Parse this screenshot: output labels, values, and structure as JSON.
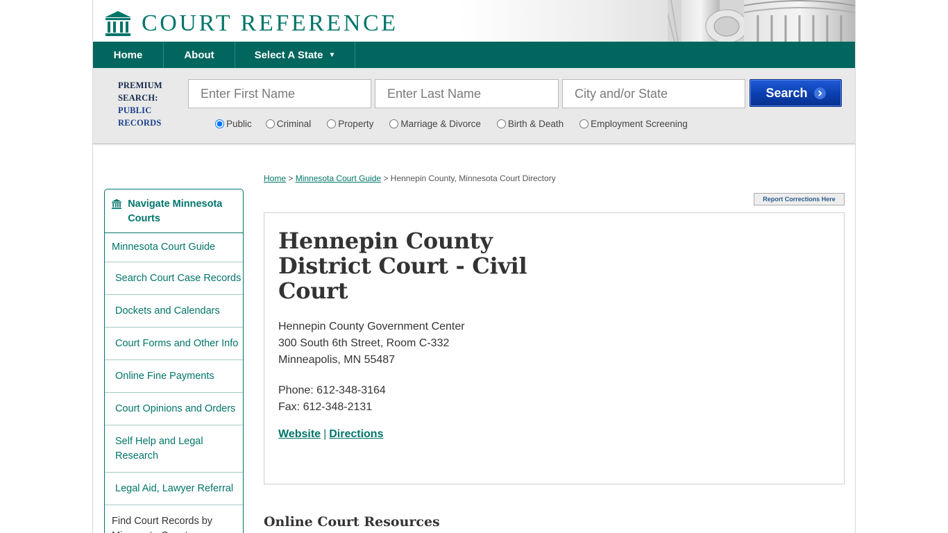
{
  "header": {
    "logo_text": "COURT REFERENCE",
    "brand_color": "#00756a",
    "icons": {
      "logo": "courthouse-icon"
    }
  },
  "nav": {
    "items": [
      {
        "label": "Home"
      },
      {
        "label": "About"
      },
      {
        "label": "Select A State",
        "caret": "▼"
      }
    ],
    "background": "#00665e"
  },
  "search": {
    "premium_line1": "PREMIUM",
    "premium_line2": "SEARCH:",
    "premium_line3": "PUBLIC",
    "premium_line4": "RECORDS",
    "first_name_placeholder": "Enter First Name",
    "last_name_placeholder": "Enter Last Name",
    "city_placeholder": "City and/or State",
    "button_label": "Search",
    "button_icon": "chevron-right-icon",
    "options": [
      {
        "label": "Public",
        "checked": true
      },
      {
        "label": "Criminal",
        "checked": false
      },
      {
        "label": "Property",
        "checked": false
      },
      {
        "label": "Marriage & Divorce",
        "checked": false
      },
      {
        "label": "Birth & Death",
        "checked": false
      },
      {
        "label": "Employment Screening",
        "checked": false
      }
    ]
  },
  "breadcrumb": {
    "home": "Home",
    "sep1": " > ",
    "guide": "Minnesota Court Guide",
    "sep2": " > ",
    "current": "Hennepin County, Minnesota Court Directory"
  },
  "report_button": "Report Corrections Here",
  "sidebar": {
    "heading": "Navigate Minnesota Courts",
    "guide": "Minnesota Court Guide",
    "items": [
      "Search Court Case Records",
      "Dockets and Calendars",
      "Court Forms and Other Info",
      "Online Fine Payments",
      "Court Opinions and Orders",
      "Self Help and Legal Research",
      "Legal Aid, Lawyer Referral"
    ],
    "find": "Find Court Records by Minnesota County"
  },
  "court": {
    "title": "Hennepin County District Court - Civil Court",
    "address_line1": "Hennepin County Government Center",
    "address_line2": "300 South 6th Street, Room C-332",
    "address_line3": "Minneapolis, MN 55487",
    "phone": "Phone: 612-348-3164",
    "fax": "Fax: 612-348-2131",
    "website_label": "Website",
    "link_separator": "|",
    "directions_label": "Directions"
  },
  "resources_heading": "Online Court Resources"
}
